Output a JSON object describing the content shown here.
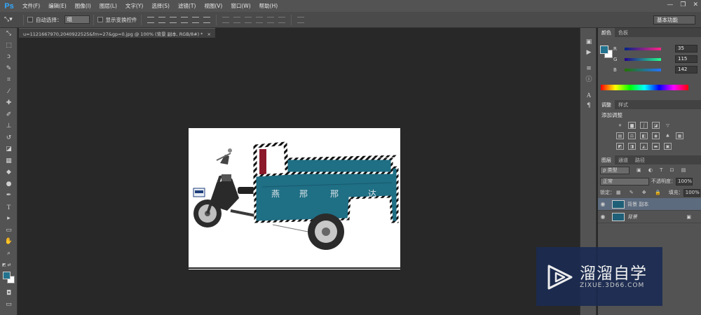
{
  "app": {
    "logo": "Ps"
  },
  "menu": [
    "文件(F)",
    "编辑(E)",
    "图像(I)",
    "图层(L)",
    "文字(Y)",
    "选择(S)",
    "滤镜(T)",
    "视图(V)",
    "窗口(W)",
    "帮助(H)"
  ],
  "options": {
    "auto_select_label": "自动选择：",
    "auto_select_value": "组",
    "show_transform_label": "显示变换控件",
    "workspace": "基本功能"
  },
  "document": {
    "tab_title": "u=1121667970,2040922525&fm=27&gp=0.jpg @ 100% (背景 副本, RGB/8#) *",
    "close_glyph": "×",
    "plate_text": "王",
    "cargo_chars": [
      "燕",
      "邢",
      "邢",
      "达"
    ]
  },
  "color_panel": {
    "tabs": [
      "颜色",
      "色板"
    ],
    "channels": [
      {
        "label": "R",
        "value": "35",
        "color_start": "#002387",
        "color_end": "#ff2387"
      },
      {
        "label": "G",
        "value": "115",
        "color_start": "#23008e",
        "color_end": "#23ff8e"
      },
      {
        "label": "B",
        "value": "142",
        "color_start": "#237300",
        "color_end": "#2373ff"
      }
    ],
    "foreground": "#23738e",
    "background": "#ffffff"
  },
  "adjust_panel": {
    "tabs": [
      "调整",
      "样式"
    ],
    "title": "添加调整"
  },
  "layers_panel": {
    "tabs": [
      "图层",
      "通道",
      "路径"
    ],
    "kind_label": "ρ 类型",
    "blend_mode": "正常",
    "opacity_label": "不透明度：",
    "opacity_value": "100%",
    "lock_label": "锁定：",
    "fill_label": "填充：",
    "fill_value": "100%",
    "layers": [
      {
        "name": "背景 副本",
        "selected": true
      },
      {
        "name": "背景",
        "selected": false
      }
    ]
  },
  "watermark": {
    "title": "溜溜自学",
    "url": "ZIXUE.3D66.COM"
  }
}
